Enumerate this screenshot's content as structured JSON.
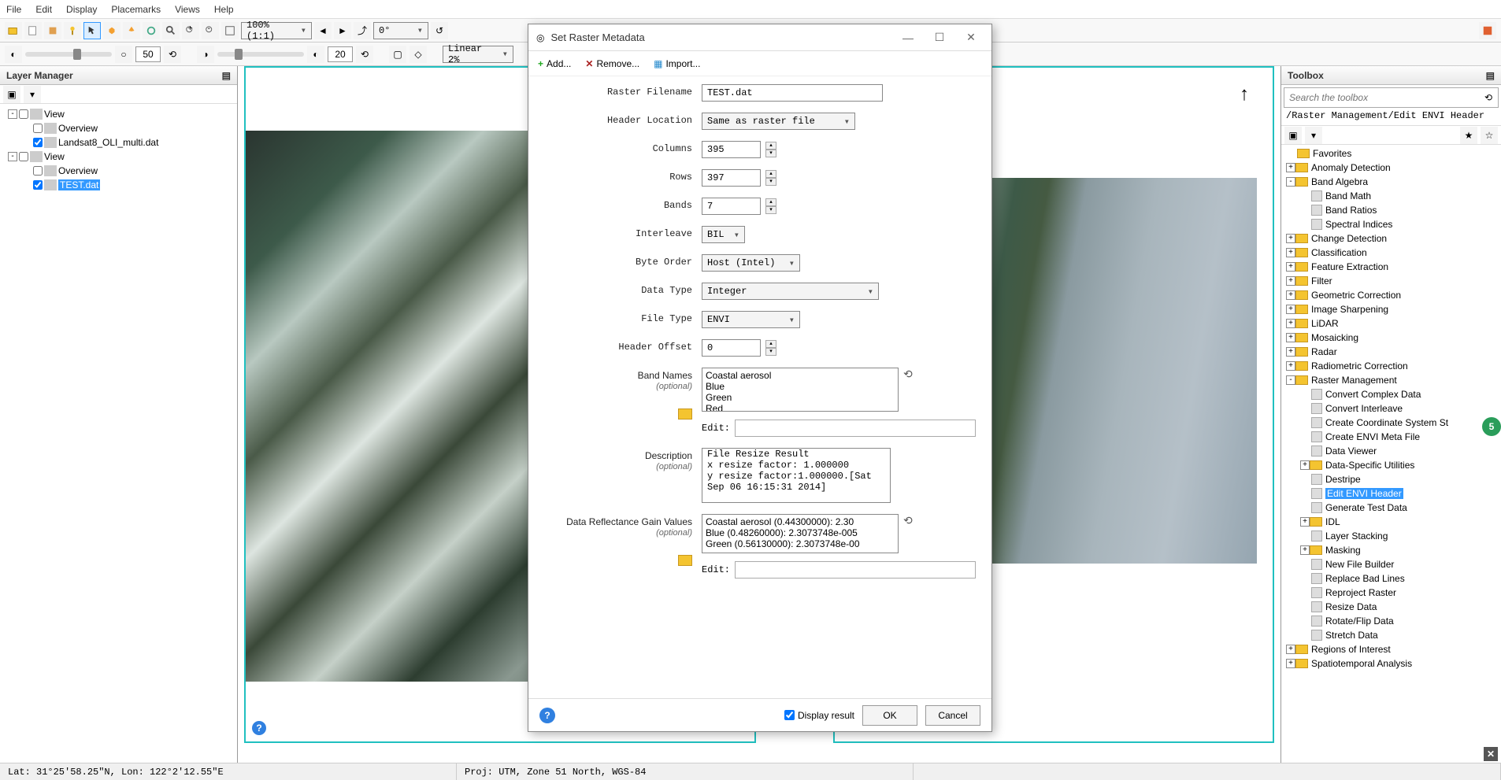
{
  "menubar": [
    "File",
    "Edit",
    "Display",
    "Placemarks",
    "Views",
    "Help"
  ],
  "toolbar1": {
    "zoom": "100% (1:1)",
    "rotation": "0°"
  },
  "toolbar2": {
    "brightness_val": "50",
    "contrast_val": "20",
    "stretch": "Linear 2%"
  },
  "layer_manager": {
    "title": "Layer Manager",
    "tree": [
      {
        "level": 0,
        "exp": "-",
        "chk": false,
        "icon": "view",
        "label": "View"
      },
      {
        "level": 1,
        "exp": "",
        "chk": false,
        "icon": "ov",
        "label": "Overview"
      },
      {
        "level": 1,
        "exp": "",
        "chk": true,
        "icon": "ras",
        "label": "Landsat8_OLI_multi.dat"
      },
      {
        "level": 0,
        "exp": "-",
        "chk": false,
        "icon": "view",
        "label": "View"
      },
      {
        "level": 1,
        "exp": "",
        "chk": false,
        "icon": "ov",
        "label": "Overview"
      },
      {
        "level": 1,
        "exp": "",
        "chk": true,
        "icon": "ras",
        "label": "TEST.dat",
        "selected": true
      }
    ]
  },
  "toolbox": {
    "title": "Toolbox",
    "search_placeholder": "Search the toolbox",
    "path": "/Raster Management/Edit ENVI Header",
    "items": [
      {
        "level": 0,
        "type": "folder",
        "exp": "",
        "label": "Favorites"
      },
      {
        "level": 0,
        "type": "folder",
        "exp": "+",
        "label": "Anomaly Detection"
      },
      {
        "level": 0,
        "type": "folder",
        "exp": "-",
        "label": "Band Algebra"
      },
      {
        "level": 1,
        "type": "tool",
        "label": "Band Math"
      },
      {
        "level": 1,
        "type": "tool",
        "label": "Band Ratios"
      },
      {
        "level": 1,
        "type": "tool",
        "label": "Spectral Indices"
      },
      {
        "level": 0,
        "type": "folder",
        "exp": "+",
        "label": "Change Detection"
      },
      {
        "level": 0,
        "type": "folder",
        "exp": "+",
        "label": "Classification"
      },
      {
        "level": 0,
        "type": "folder",
        "exp": "+",
        "label": "Feature Extraction"
      },
      {
        "level": 0,
        "type": "folder",
        "exp": "+",
        "label": "Filter"
      },
      {
        "level": 0,
        "type": "folder",
        "exp": "+",
        "label": "Geometric Correction"
      },
      {
        "level": 0,
        "type": "folder",
        "exp": "+",
        "label": "Image Sharpening"
      },
      {
        "level": 0,
        "type": "folder",
        "exp": "+",
        "label": "LiDAR"
      },
      {
        "level": 0,
        "type": "folder",
        "exp": "+",
        "label": "Mosaicking"
      },
      {
        "level": 0,
        "type": "folder",
        "exp": "+",
        "label": "Radar"
      },
      {
        "level": 0,
        "type": "folder",
        "exp": "+",
        "label": "Radiometric Correction"
      },
      {
        "level": 0,
        "type": "folder",
        "exp": "-",
        "label": "Raster Management"
      },
      {
        "level": 1,
        "type": "tool",
        "label": "Convert Complex Data"
      },
      {
        "level": 1,
        "type": "tool",
        "label": "Convert Interleave"
      },
      {
        "level": 1,
        "type": "tool",
        "label": "Create Coordinate System St"
      },
      {
        "level": 1,
        "type": "tool",
        "label": "Create ENVI Meta File"
      },
      {
        "level": 1,
        "type": "tool",
        "label": "Data Viewer"
      },
      {
        "level": 1,
        "type": "folder",
        "exp": "+",
        "label": "Data-Specific Utilities"
      },
      {
        "level": 1,
        "type": "tool",
        "label": "Destripe"
      },
      {
        "level": 1,
        "type": "tool",
        "label": "Edit ENVI Header",
        "selected": true
      },
      {
        "level": 1,
        "type": "tool",
        "label": "Generate Test Data"
      },
      {
        "level": 1,
        "type": "folder",
        "exp": "+",
        "label": "IDL"
      },
      {
        "level": 1,
        "type": "tool",
        "label": "Layer Stacking"
      },
      {
        "level": 1,
        "type": "folder",
        "exp": "+",
        "label": "Masking"
      },
      {
        "level": 1,
        "type": "tool",
        "label": "New File Builder"
      },
      {
        "level": 1,
        "type": "tool",
        "label": "Replace Bad Lines"
      },
      {
        "level": 1,
        "type": "tool",
        "label": "Reproject Raster"
      },
      {
        "level": 1,
        "type": "tool",
        "label": "Resize Data"
      },
      {
        "level": 1,
        "type": "tool",
        "label": "Rotate/Flip Data"
      },
      {
        "level": 1,
        "type": "tool",
        "label": "Stretch Data"
      },
      {
        "level": 0,
        "type": "folder",
        "exp": "+",
        "label": "Regions of Interest"
      },
      {
        "level": 0,
        "type": "folder",
        "exp": "+",
        "label": "Spatiotemporal Analysis"
      }
    ]
  },
  "dialog": {
    "title": "Set Raster Metadata",
    "tools": {
      "add": "Add...",
      "remove": "Remove...",
      "import": "Import..."
    },
    "fields": {
      "raster_filename": {
        "label": "Raster Filename",
        "value": "TEST.dat"
      },
      "header_location": {
        "label": "Header Location",
        "value": "Same as raster file"
      },
      "columns": {
        "label": "Columns",
        "value": "395"
      },
      "rows": {
        "label": "Rows",
        "value": "397"
      },
      "bands": {
        "label": "Bands",
        "value": "7"
      },
      "interleave": {
        "label": "Interleave",
        "value": "BIL"
      },
      "byte_order": {
        "label": "Byte Order",
        "value": "Host (Intel)"
      },
      "data_type": {
        "label": "Data Type",
        "value": "Integer"
      },
      "file_type": {
        "label": "File Type",
        "value": "ENVI"
      },
      "header_offset": {
        "label": "Header Offset",
        "value": "0"
      },
      "band_names": {
        "label": "Band Names",
        "optional": "(optional)",
        "items": [
          "Coastal aerosol",
          "Blue",
          "Green",
          "Red"
        ],
        "edit_label": "Edit:"
      },
      "description": {
        "label": "Description",
        "optional": "(optional)",
        "value": "File Resize Result\nx resize factor: 1.000000\ny resize factor:1.000000.[Sat Sep 06 16:15:31 2014]"
      },
      "reflectance": {
        "label": "Data Reflectance Gain Values",
        "optional": "(optional)",
        "items": [
          "Coastal aerosol (0.44300000): 2.30",
          "Blue (0.48260000): 2.3073748e-005",
          "Green (0.56130000): 2.3073748e-00"
        ],
        "edit_label": "Edit:"
      }
    },
    "footer": {
      "display_result": "Display result",
      "ok": "OK",
      "cancel": "Cancel"
    }
  },
  "status": {
    "coords": "Lat: 31°25'58.25\"N, Lon: 122°2'12.55\"E",
    "proj": "Proj: UTM, Zone 51 North, WGS-84"
  },
  "side_badge": "5"
}
